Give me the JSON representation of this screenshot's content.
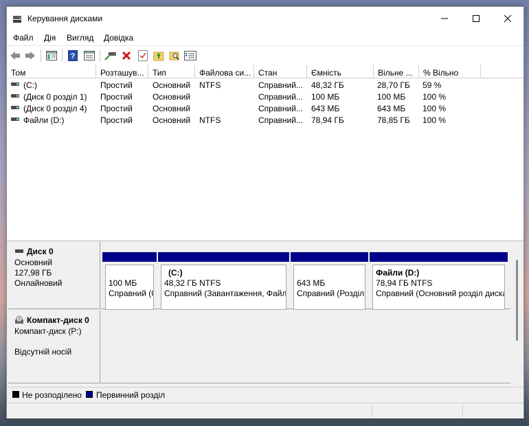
{
  "window": {
    "title": "Керування дисками"
  },
  "menu": [
    "Файл",
    "Дія",
    "Вигляд",
    "Довідка"
  ],
  "toolbar": [
    "back-icon",
    "forward-icon",
    "console-tree-icon",
    "help-icon",
    "properties-view-icon",
    "connect-disk-icon",
    "delete-icon",
    "check-icon",
    "up-folder-icon",
    "search-folder-icon",
    "info-icon"
  ],
  "volumes": {
    "columns": [
      "Том",
      "Розташув...",
      "Тип",
      "Файлова си...",
      "Стан",
      "Ємність",
      "Вільне ...",
      "% Вільно"
    ],
    "rows": [
      [
        "(C:)",
        "Простий",
        "Основний",
        "NTFS",
        "Справний...",
        "48,32 ГБ",
        "28,70 ГБ",
        "59 %"
      ],
      [
        "(Диск 0 розділ 1)",
        "Простий",
        "Основний",
        "",
        "Справний...",
        "100 МБ",
        "100 МБ",
        "100 %"
      ],
      [
        "(Диск 0 розділ 4)",
        "Простий",
        "Основний",
        "",
        "Справний...",
        "643 МБ",
        "643 МБ",
        "100 %"
      ],
      [
        "Файли (D:)",
        "Простий",
        "Основний",
        "NTFS",
        "Справний...",
        "78,94 ГБ",
        "78,85 ГБ",
        "100 %"
      ]
    ]
  },
  "disks": [
    {
      "name": "Диск 0",
      "type": "Основний",
      "size": "127,98 ГБ",
      "status": "Онлайновий",
      "partitions": [
        {
          "title": "",
          "size": "100 МБ",
          "status": "Справний (С"
        },
        {
          "title": "(C:)",
          "size": "48,32 ГБ NTFS",
          "status": "Справний (Завантаження, Файл"
        },
        {
          "title": "",
          "size": "643 МБ",
          "status": "Справний (Розділ"
        },
        {
          "title": "Файли  (D:)",
          "size": "78,94 ГБ NTFS",
          "status": "Справний (Основний розділ диска"
        }
      ]
    },
    {
      "name": "Компакт-диск 0",
      "type": "Компакт-диск (P:)",
      "status": "Відсутній носій"
    }
  ],
  "legend": [
    {
      "label": "Не розподілено",
      "color": "#000000"
    },
    {
      "label": "Первинний розділ",
      "color": "#00008b"
    }
  ],
  "colors": {
    "primary_partition": "#00008b",
    "unallocated": "#000000"
  }
}
